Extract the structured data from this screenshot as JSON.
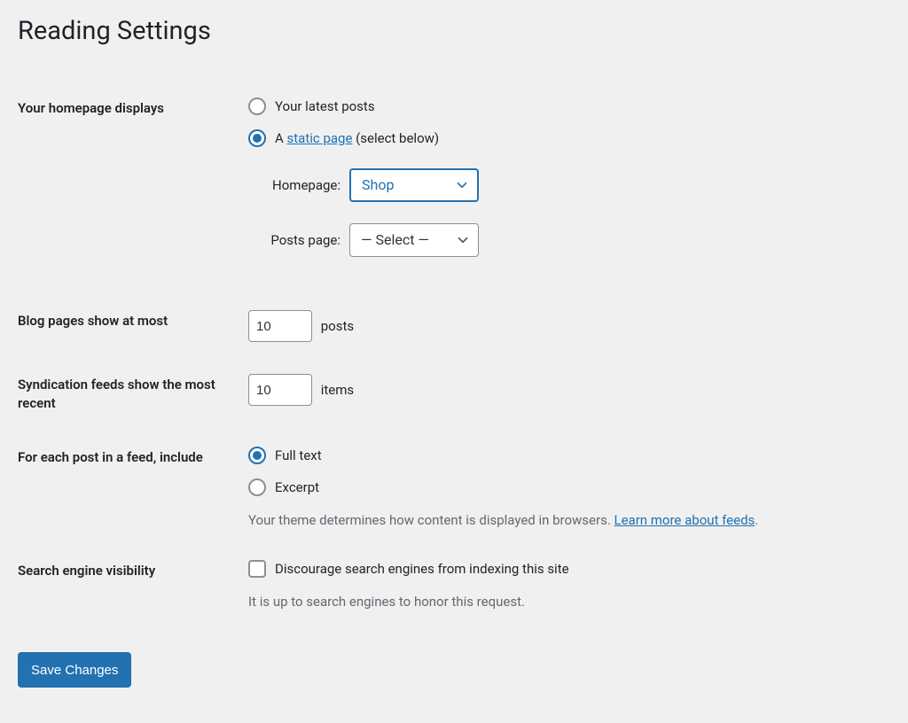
{
  "title": "Reading Settings",
  "homepage": {
    "label": "Your homepage displays",
    "opt_latest": "Your latest posts",
    "opt_static_prefix": "A ",
    "opt_static_link": "static page",
    "opt_static_suffix": " (select below)",
    "selected": "static",
    "homepage_label": "Homepage:",
    "homepage_value": "Shop",
    "postspage_label": "Posts page:",
    "postspage_value": "— Select —"
  },
  "blog_pages": {
    "label": "Blog pages show at most",
    "value": "10",
    "unit": "posts"
  },
  "syndication": {
    "label": "Syndication feeds show the most recent",
    "value": "10",
    "unit": "items"
  },
  "feed_content": {
    "label": "For each post in a feed, include",
    "opt_full": "Full text",
    "opt_excerpt": "Excerpt",
    "selected": "full",
    "desc_prefix": "Your theme determines how content is displayed in browsers. ",
    "desc_link": "Learn more about feeds",
    "desc_suffix": "."
  },
  "search_visibility": {
    "label": "Search engine visibility",
    "checkbox_label": "Discourage search engines from indexing this site",
    "checked": false,
    "desc": "It is up to search engines to honor this request."
  },
  "submit_label": "Save Changes"
}
